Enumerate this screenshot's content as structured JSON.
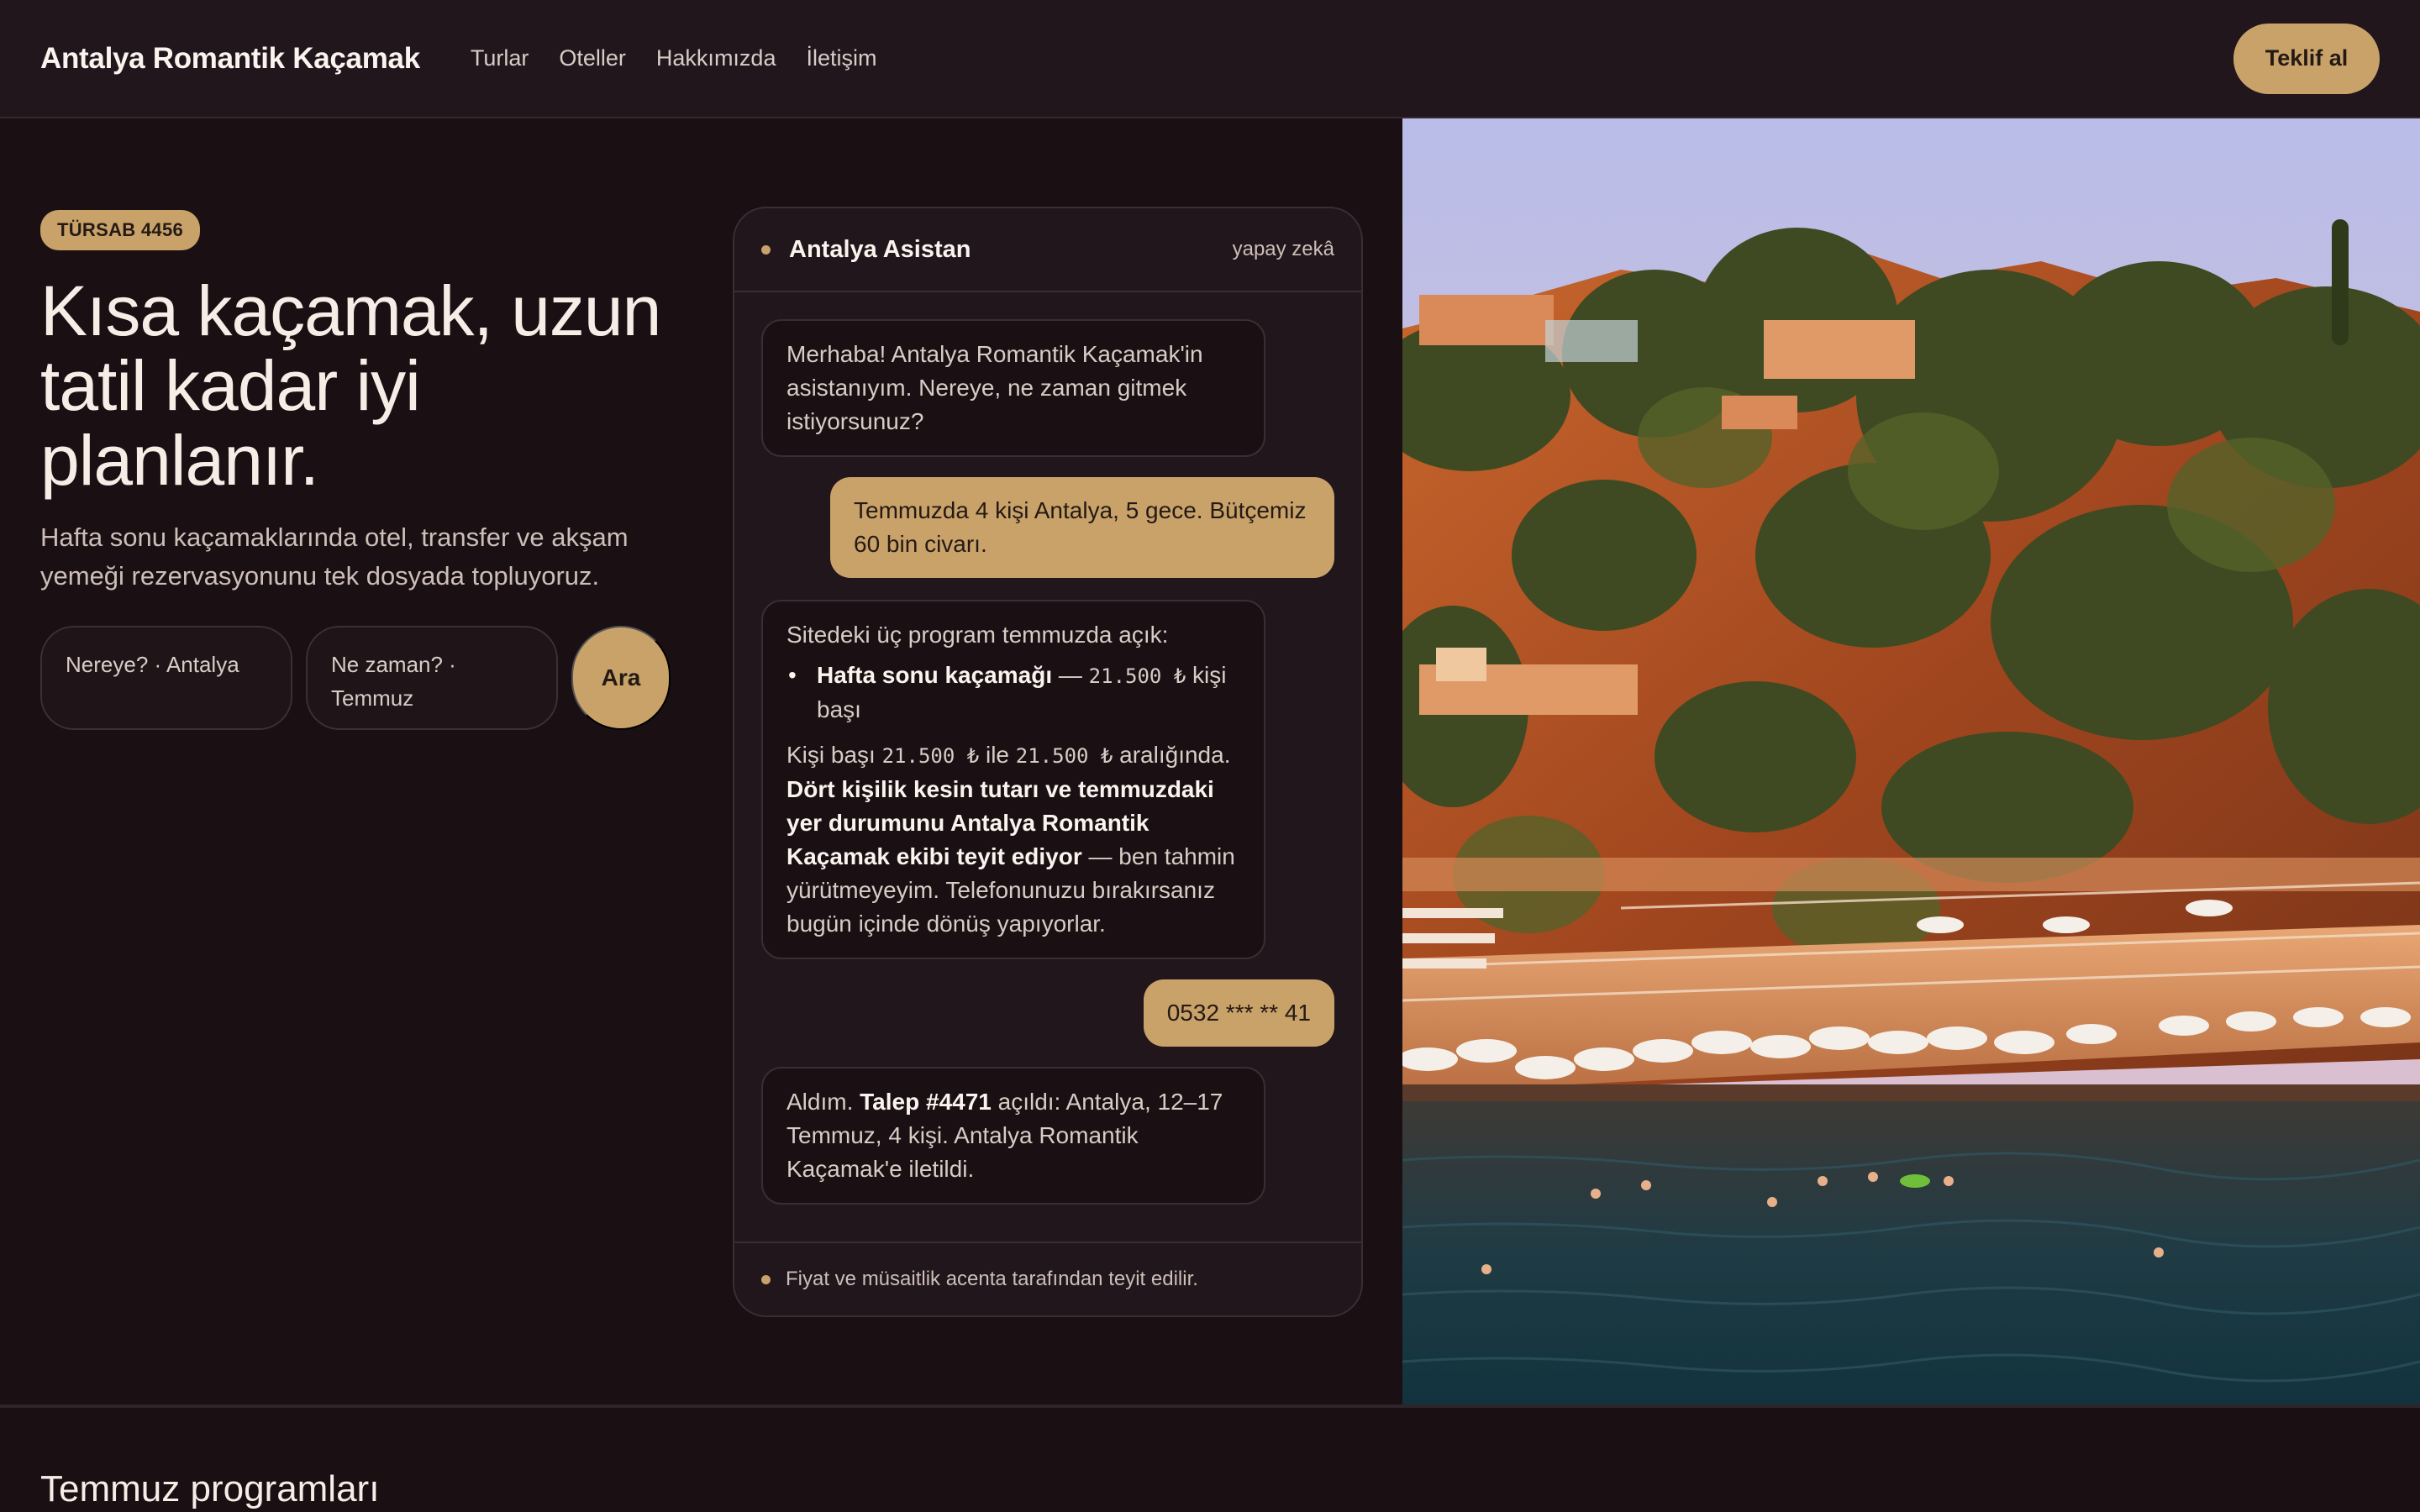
{
  "header": {
    "brand": "Antalya Romantik Kaçamak",
    "nav": [
      "Turlar",
      "Oteller",
      "Hakkımızda",
      "İletişim"
    ],
    "cta": "Teklif al"
  },
  "hero": {
    "badge": "TÜRSAB 4456",
    "headline": "Kısa kaçamak, uzun tatil kadar iyi planlanır.",
    "subtitle": "Hafta sonu kaçamaklarında otel, transfer ve akşam yemeği rezervasyonunu tek dosyada topluyoruz.",
    "search": {
      "where": "Nereye? · Antalya",
      "when": "Ne zaman? · Temmuz",
      "button": "Ara"
    }
  },
  "chat": {
    "title": "Antalya Asistan",
    "tag": "yapay zekâ",
    "messages": {
      "m1": "Merhaba! Antalya Romantik Kaçamak'in asistanıyım. Nereye, ne zaman gitmek istiyorsunuz?",
      "m2": "Temmuzda 4 kişi Antalya, 5 gece. Bütçemiz 60 bin civarı.",
      "m3_intro": "Sitedeki üç program temmuzda açık:",
      "m3_item_name": "Hafta sonu kaçamağı",
      "m3_item_sep": " — ",
      "m3_item_price": "21.500 ₺",
      "m3_item_unit": " kişi başı",
      "m3_p2_a": "Kişi başı ",
      "m3_p2_price1": "21.500 ₺",
      "m3_p2_b": " ile ",
      "m3_p2_price2": "21.500 ₺",
      "m3_p2_c": " aralığında. ",
      "m3_p2_strong": "Dört kişilik kesin tutarı ve temmuzdaki yer durumunu Antalya Romantik Kaçamak ekibi teyit ediyor",
      "m3_p2_d": " — ben tahmin yürütmeyeyim. Telefonunuzu bırakırsanız bugün içinde dönüş yapıyorlar.",
      "m4": "0532 *** ** 41",
      "m5_a": "Aldım. ",
      "m5_strong": "Talep #4471",
      "m5_b": " açıldı: Antalya, 12–17 Temmuz, 4 kişi. Antalya Romantik Kaçamak'e iletildi."
    },
    "footer": "Fiyat ve müsaitlik acenta tarafından teyit edilir."
  },
  "photo": {
    "alt": "coastal-cliff-beach-photo"
  },
  "section": {
    "title": "Temmuz programları"
  },
  "colors": {
    "accent": "#c9a26a",
    "bg": "#1a1013",
    "surface": "#21161c"
  }
}
